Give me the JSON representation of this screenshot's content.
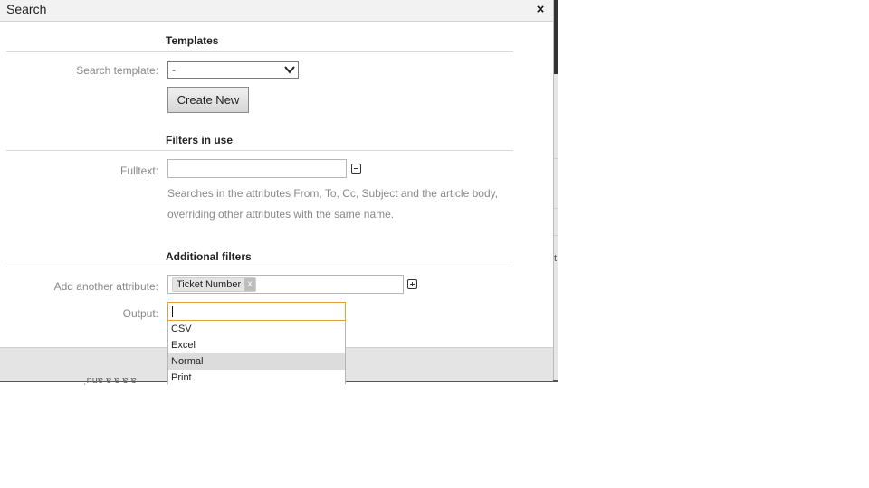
{
  "dialog": {
    "title": "Search",
    "close_symbol": "×"
  },
  "templates": {
    "heading": "Templates",
    "search_template_label": "Search template:",
    "search_template_value": "-",
    "create_new_label": "Create New"
  },
  "filters": {
    "heading": "Filters in use",
    "fulltext_label": "Fulltext:",
    "fulltext_value": "",
    "hint_line1": "Searches in the attributes From, To, Cc, Subject and the article body,",
    "hint_line2": "overriding other attributes with the same name."
  },
  "additional": {
    "heading": "Additional filters",
    "add_attribute_label": "Add another attribute:",
    "token_label": "Ticket Number",
    "token_remove": "x",
    "output_label": "Output:",
    "output_value": "",
    "output_options": [
      "CSV",
      "Excel",
      "Normal",
      "Print"
    ],
    "output_highlighted": "Normal"
  },
  "background": {
    "under_text": "ˌnuɐ ɐ ɐ ɐ ɐ",
    "edge_fragment": "t"
  }
}
